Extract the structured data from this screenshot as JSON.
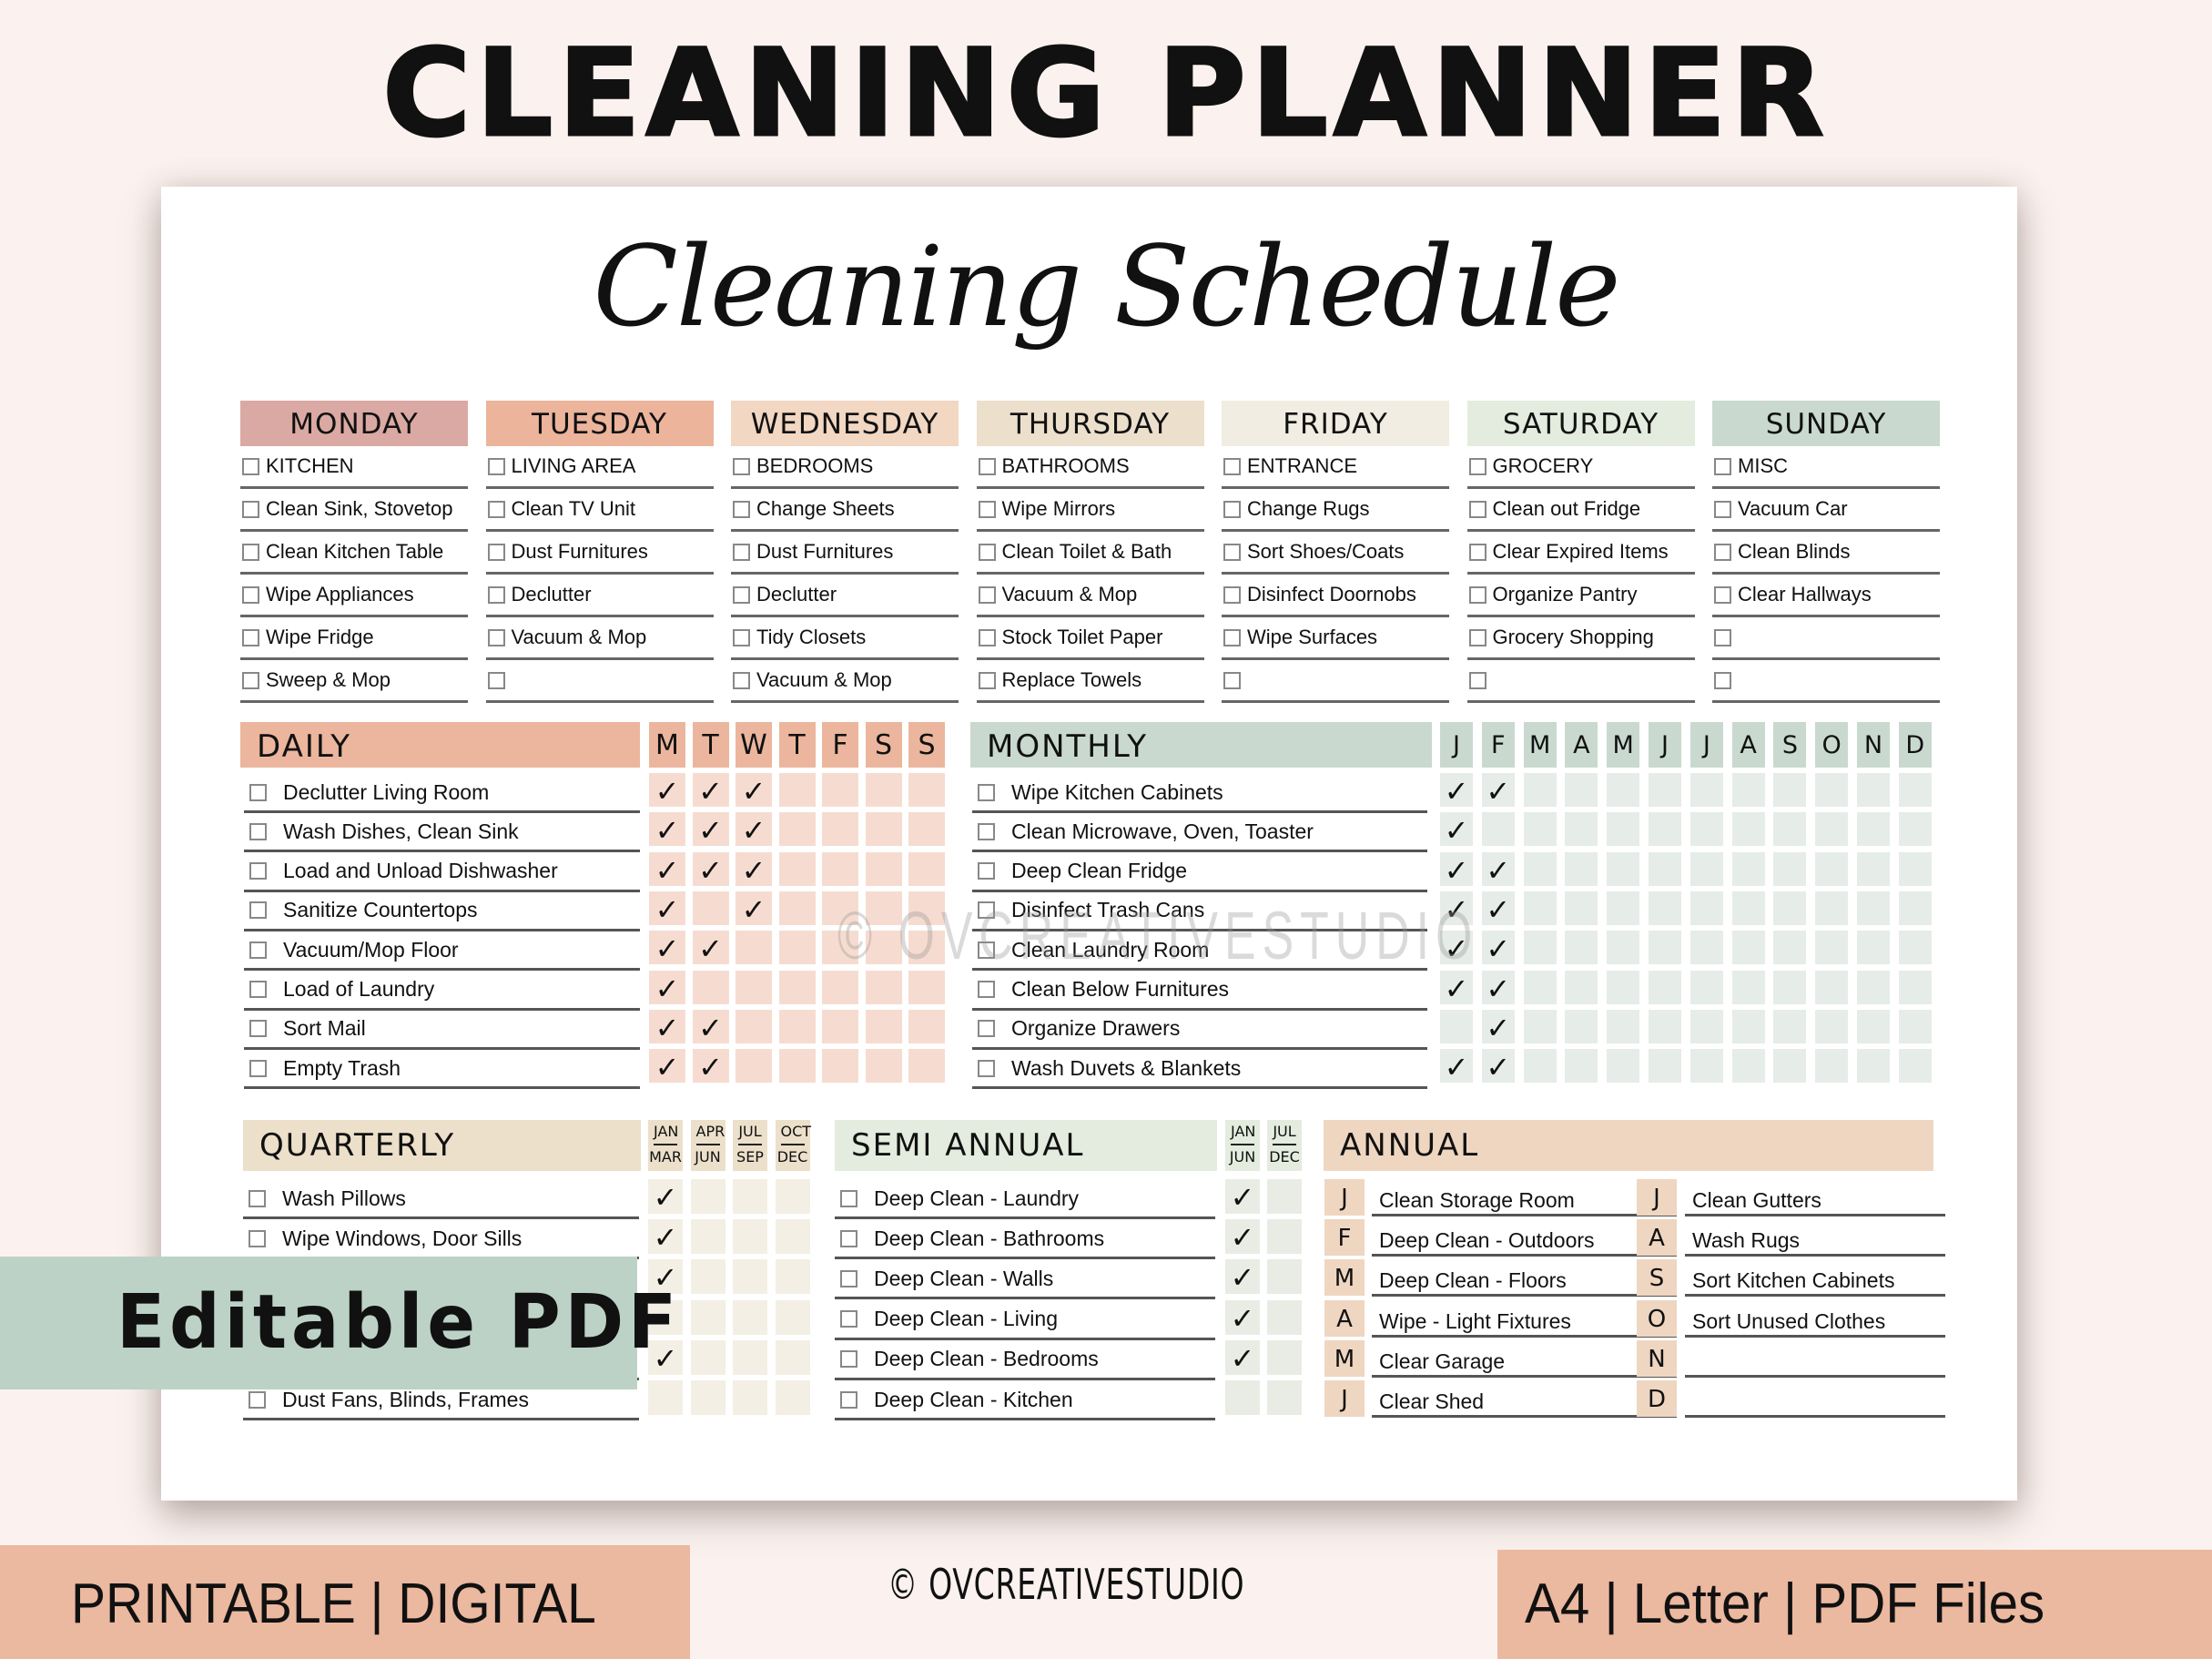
{
  "banner_title": "CLEANING PLANNER",
  "schedule_title": "Cleaning Schedule",
  "colors": {
    "background": "#fbf2ef",
    "monday": "#dba9a3",
    "tuesday": "#ebb49b",
    "wednesday": "#f2d7c2",
    "thursday": "#ece0cc",
    "friday": "#f1ede2",
    "saturday": "#e3ecde",
    "sunday": "#c9d9cf",
    "daily_header": "#ebb69d",
    "daily_cell": "#f6dcd0",
    "monthly_header": "#c9d9cf",
    "monthly_cell": "#e6ece7",
    "quarterly_header": "#ece0cb",
    "quarterly_cell": "#f3efe4",
    "semi_header": "#e3ecde",
    "semi_cell": "#e9ece4",
    "annual_header": "#efd6c1",
    "badge_green": "#bcd2c7",
    "badge_peach": "#ebb8a0"
  },
  "weekly": [
    {
      "day": "MONDAY",
      "items": [
        "KITCHEN",
        "Clean Sink, Stovetop",
        "Clean Kitchen Table",
        "Wipe Appliances",
        "Wipe Fridge",
        "Sweep & Mop"
      ]
    },
    {
      "day": "TUESDAY",
      "items": [
        "LIVING AREA",
        "Clean TV Unit",
        "Dust Furnitures",
        "Declutter",
        "Vacuum & Mop",
        ""
      ]
    },
    {
      "day": "WEDNESDAY",
      "items": [
        "BEDROOMS",
        "Change Sheets",
        "Dust Furnitures",
        "Declutter",
        "Tidy Closets",
        "Vacuum & Mop"
      ]
    },
    {
      "day": "THURSDAY",
      "items": [
        "BATHROOMS",
        "Wipe Mirrors",
        "Clean Toilet & Bath",
        "Vacuum & Mop",
        "Stock Toilet Paper",
        "Replace Towels"
      ]
    },
    {
      "day": "FRIDAY",
      "items": [
        "ENTRANCE",
        "Change Rugs",
        "Sort Shoes/Coats",
        "Disinfect Doornobs",
        "Wipe Surfaces",
        ""
      ]
    },
    {
      "day": "SATURDAY",
      "items": [
        "GROCERY",
        "Clean out Fridge",
        "Clear Expired Items",
        "Organize Pantry",
        "Grocery Shopping",
        ""
      ]
    },
    {
      "day": "SUNDAY",
      "items": [
        "MISC",
        "Vacuum Car",
        "Clean Blinds",
        "Clear Hallways",
        "",
        ""
      ]
    }
  ],
  "daily": {
    "title": "DAILY",
    "columns": [
      "M",
      "T",
      "W",
      "T",
      "F",
      "S",
      "S"
    ],
    "tasks": [
      {
        "label": "Declutter Living Room",
        "checks": [
          1,
          1,
          1,
          0,
          0,
          0,
          0
        ]
      },
      {
        "label": "Wash Dishes, Clean Sink",
        "checks": [
          1,
          1,
          1,
          0,
          0,
          0,
          0
        ]
      },
      {
        "label": "Load and Unload Dishwasher",
        "checks": [
          1,
          1,
          1,
          0,
          0,
          0,
          0
        ]
      },
      {
        "label": "Sanitize Countertops",
        "checks": [
          1,
          0,
          1,
          0,
          0,
          0,
          0
        ]
      },
      {
        "label": "Vacuum/Mop Floor",
        "checks": [
          1,
          1,
          0,
          0,
          0,
          0,
          0
        ]
      },
      {
        "label": "Load of Laundry",
        "checks": [
          1,
          0,
          0,
          0,
          0,
          0,
          0
        ]
      },
      {
        "label": "Sort Mail",
        "checks": [
          1,
          1,
          0,
          0,
          0,
          0,
          0
        ]
      },
      {
        "label": "Empty Trash",
        "checks": [
          1,
          1,
          0,
          0,
          0,
          0,
          0
        ]
      }
    ]
  },
  "monthly": {
    "title": "MONTHLY",
    "columns": [
      "J",
      "F",
      "M",
      "A",
      "M",
      "J",
      "J",
      "A",
      "S",
      "O",
      "N",
      "D"
    ],
    "tasks": [
      {
        "label": "Wipe Kitchen Cabinets",
        "checks": [
          1,
          1,
          0,
          0,
          0,
          0,
          0,
          0,
          0,
          0,
          0,
          0
        ]
      },
      {
        "label": "Clean Microwave, Oven, Toaster",
        "checks": [
          1,
          0,
          0,
          0,
          0,
          0,
          0,
          0,
          0,
          0,
          0,
          0
        ]
      },
      {
        "label": "Deep Clean Fridge",
        "checks": [
          1,
          1,
          0,
          0,
          0,
          0,
          0,
          0,
          0,
          0,
          0,
          0
        ]
      },
      {
        "label": "Disinfect Trash Cans",
        "checks": [
          1,
          1,
          0,
          0,
          0,
          0,
          0,
          0,
          0,
          0,
          0,
          0
        ]
      },
      {
        "label": "Clean Laundry Room",
        "checks": [
          1,
          1,
          0,
          0,
          0,
          0,
          0,
          0,
          0,
          0,
          0,
          0
        ]
      },
      {
        "label": "Clean Below Furnitures",
        "checks": [
          1,
          1,
          0,
          0,
          0,
          0,
          0,
          0,
          0,
          0,
          0,
          0
        ]
      },
      {
        "label": "Organize Drawers",
        "checks": [
          0,
          1,
          0,
          0,
          0,
          0,
          0,
          0,
          0,
          0,
          0,
          0
        ]
      },
      {
        "label": "Wash Duvets & Blankets",
        "checks": [
          1,
          1,
          0,
          0,
          0,
          0,
          0,
          0,
          0,
          0,
          0,
          0
        ]
      }
    ]
  },
  "quarterly": {
    "title": "QUARTERLY",
    "columns": [
      {
        "top": "JAN",
        "bottom": "MAR"
      },
      {
        "top": "APR",
        "bottom": "JUN"
      },
      {
        "top": "JUL",
        "bottom": "SEP"
      },
      {
        "top": "OCT",
        "bottom": "DEC"
      }
    ],
    "tasks": [
      {
        "label": "Wash Pillows",
        "checks": [
          1,
          0,
          0,
          0
        ]
      },
      {
        "label": "Wipe Windows, Door Sills",
        "checks": [
          1,
          0,
          0,
          0
        ]
      },
      {
        "label": "",
        "checks": [
          1,
          0,
          0,
          0
        ]
      },
      {
        "label": "",
        "checks": [
          0,
          0,
          0,
          0
        ]
      },
      {
        "label": "",
        "checks": [
          1,
          0,
          0,
          0
        ]
      },
      {
        "label": "Dust Fans, Blinds, Frames",
        "checks": [
          0,
          0,
          0,
          0
        ]
      }
    ]
  },
  "semi_annual": {
    "title": "SEMI ANNUAL",
    "columns": [
      {
        "top": "JAN",
        "bottom": "JUN"
      },
      {
        "top": "JUL",
        "bottom": "DEC"
      }
    ],
    "tasks": [
      {
        "label": "Deep Clean - Laundry",
        "checks": [
          1,
          0
        ]
      },
      {
        "label": "Deep Clean - Bathrooms",
        "checks": [
          1,
          0
        ]
      },
      {
        "label": "Deep Clean - Walls",
        "checks": [
          1,
          0
        ]
      },
      {
        "label": "Deep Clean - Living",
        "checks": [
          1,
          0
        ]
      },
      {
        "label": "Deep Clean - Bedrooms",
        "checks": [
          1,
          0
        ]
      },
      {
        "label": "Deep Clean - Kitchen",
        "checks": [
          0,
          0
        ]
      }
    ]
  },
  "annual": {
    "title": "ANNUAL",
    "left": [
      {
        "month": "J",
        "task": "Clean Storage Room"
      },
      {
        "month": "F",
        "task": "Deep Clean - Outdoors"
      },
      {
        "month": "M",
        "task": "Deep Clean - Floors"
      },
      {
        "month": "A",
        "task": "Wipe - Light Fixtures"
      },
      {
        "month": "M",
        "task": "Clear Garage"
      },
      {
        "month": "J",
        "task": "Clear Shed"
      }
    ],
    "right": [
      {
        "month": "J",
        "task": "Clean Gutters"
      },
      {
        "month": "A",
        "task": "Wash Rugs"
      },
      {
        "month": "S",
        "task": "Sort Kitchen Cabinets"
      },
      {
        "month": "O",
        "task": "Sort Unused Clothes"
      },
      {
        "month": "N",
        "task": ""
      },
      {
        "month": "D",
        "task": ""
      }
    ]
  },
  "check_glyph": "✓",
  "watermark": "© OVCREATIVESTUDIO",
  "badges": {
    "editable": "Editable PDF",
    "printable": "PRINTABLE | DIGITAL",
    "copyright": "© OVCREATIVESTUDIO",
    "formats": "A4 | Letter | PDF Files"
  }
}
